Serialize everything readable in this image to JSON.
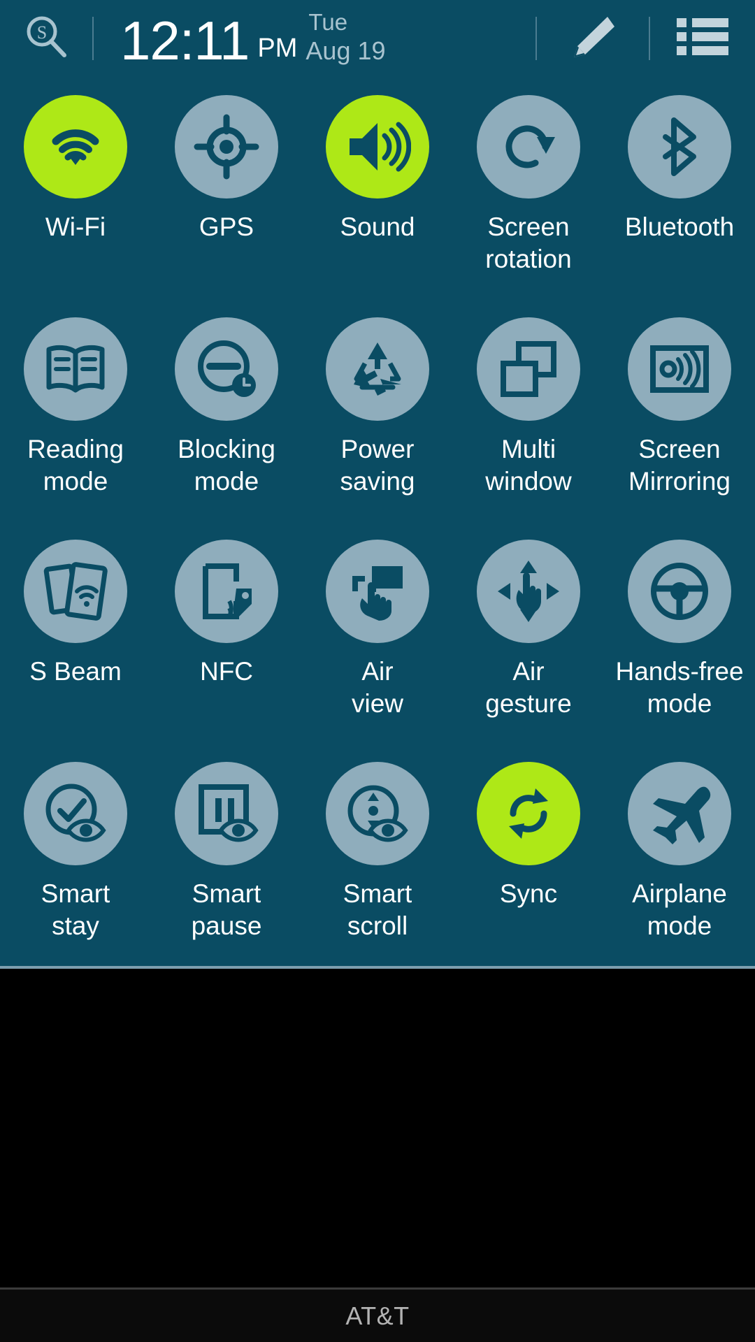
{
  "theme": {
    "panel_background": "#0a4c63",
    "inactive_circle": "#8fadbc",
    "active_circle": "#aee817",
    "icon_glyph": "#0a4c63",
    "label_text": "#ffffff",
    "carrier_text": "#b3b3b3",
    "black_area": "#000000"
  },
  "statusbar": {
    "s_finder_icon": "s-finder-search-icon",
    "time": "12:11",
    "ampm": "PM",
    "day_of_week": "Tue",
    "month_day": "Aug 19",
    "edit_icon": "pencil-edit-icon",
    "list_icon": "list-menu-icon"
  },
  "toggles": [
    {
      "id": "wifi",
      "label": "Wi-Fi",
      "icon": "wifi-icon",
      "active": true
    },
    {
      "id": "gps",
      "label": "GPS",
      "icon": "gps-crosshair-icon",
      "active": false
    },
    {
      "id": "sound",
      "label": "Sound",
      "icon": "speaker-sound-icon",
      "active": true
    },
    {
      "id": "screen-rotation",
      "label": "Screen\nrotation",
      "icon": "rotate-screen-icon",
      "active": false
    },
    {
      "id": "bluetooth",
      "label": "Bluetooth",
      "icon": "bluetooth-icon",
      "active": false
    },
    {
      "id": "reading-mode",
      "label": "Reading\nmode",
      "icon": "open-book-icon",
      "active": false
    },
    {
      "id": "blocking-mode",
      "label": "Blocking\nmode",
      "icon": "block-clock-icon",
      "active": false
    },
    {
      "id": "power-saving",
      "label": "Power\nsaving",
      "icon": "recycle-icon",
      "active": false
    },
    {
      "id": "multi-window",
      "label": "Multi\nwindow",
      "icon": "multi-window-icon",
      "active": false
    },
    {
      "id": "screen-mirroring",
      "label": "Screen\nMirroring",
      "icon": "screen-mirror-icon",
      "active": false
    },
    {
      "id": "s-beam",
      "label": "S Beam",
      "icon": "s-beam-icon",
      "active": false
    },
    {
      "id": "nfc",
      "label": "NFC",
      "icon": "nfc-tag-icon",
      "active": false
    },
    {
      "id": "air-view",
      "label": "Air\nview",
      "icon": "air-view-hand-icon",
      "active": false
    },
    {
      "id": "air-gesture",
      "label": "Air\ngesture",
      "icon": "air-gesture-icon",
      "active": false
    },
    {
      "id": "hands-free-mode",
      "label": "Hands-free\nmode",
      "icon": "steering-wheel-icon",
      "active": false
    },
    {
      "id": "smart-stay",
      "label": "Smart\nstay",
      "icon": "smart-stay-eye-icon",
      "active": false
    },
    {
      "id": "smart-pause",
      "label": "Smart\npause",
      "icon": "smart-pause-eye-icon",
      "active": false
    },
    {
      "id": "smart-scroll",
      "label": "Smart\nscroll",
      "icon": "smart-scroll-eye-icon",
      "active": false
    },
    {
      "id": "sync",
      "label": "Sync",
      "icon": "sync-refresh-icon",
      "active": true
    },
    {
      "id": "airplane-mode",
      "label": "Airplane\nmode",
      "icon": "airplane-icon",
      "active": false
    }
  ],
  "carrier": {
    "name": "AT&T"
  }
}
